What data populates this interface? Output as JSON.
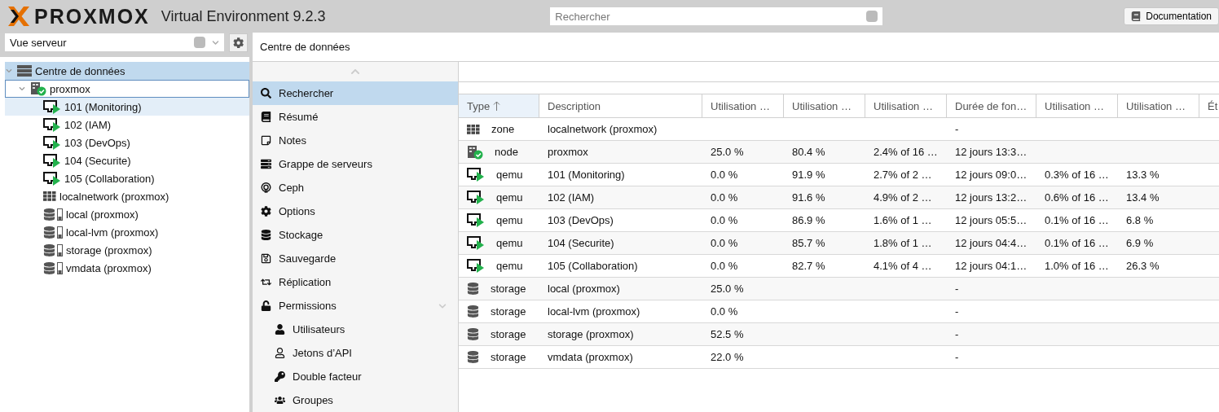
{
  "header": {
    "logo": "PROXMOX",
    "product": "Virtual Environment 9.2.3",
    "search": {
      "placeholder": "Rechercher"
    },
    "buttons": [
      {
        "label": "Documentation"
      }
    ]
  },
  "sidebar": {
    "view_select": {
      "value": "Vue serveur"
    },
    "tree": [
      {
        "label": "Centre de données",
        "kind": "datacenter",
        "selected": true,
        "focused": false,
        "hovered": false,
        "expanded": true,
        "children": [
          {
            "label": "proxmox",
            "kind": "node",
            "selected": false,
            "focused": true,
            "hovered": false,
            "expanded": true,
            "children": [
              {
                "label": "101 (Monitoring)",
                "kind": "vm",
                "selected": false,
                "focused": false,
                "hovered": true
              },
              {
                "label": "102 (IAM)",
                "kind": "vm",
                "selected": false,
                "focused": false,
                "hovered": false
              },
              {
                "label": "103 (DevOps)",
                "kind": "vm",
                "selected": false,
                "focused": false,
                "hovered": false
              },
              {
                "label": "104 (Securite)",
                "kind": "vm",
                "selected": false,
                "focused": false,
                "hovered": false
              },
              {
                "label": "105 (Collaboration)",
                "kind": "vm",
                "selected": false,
                "focused": false,
                "hovered": false
              },
              {
                "label": "localnetwork (proxmox)",
                "kind": "zone",
                "selected": false,
                "focused": false,
                "hovered": false
              },
              {
                "label": "local (proxmox)",
                "kind": "storage",
                "selected": false,
                "focused": false,
                "hovered": false
              },
              {
                "label": "local-lvm (proxmox)",
                "kind": "storage",
                "selected": false,
                "focused": false,
                "hovered": false
              },
              {
                "label": "storage (proxmox)",
                "kind": "storage",
                "selected": false,
                "focused": false,
                "hovered": false
              },
              {
                "label": "vmdata (proxmox)",
                "kind": "storage",
                "selected": false,
                "focused": false,
                "hovered": false
              }
            ]
          }
        ]
      }
    ]
  },
  "content": {
    "title": "Centre de données",
    "nav": [
      {
        "label": "Rechercher",
        "selected": true
      },
      {
        "label": "Résumé",
        "selected": false
      },
      {
        "label": "Notes",
        "selected": false
      },
      {
        "label": "Grappe de serveurs",
        "selected": false
      },
      {
        "label": "Ceph",
        "selected": false
      },
      {
        "label": "Options",
        "selected": false
      },
      {
        "label": "Stockage",
        "selected": false
      },
      {
        "label": "Sauvegarde",
        "selected": false
      },
      {
        "label": "Réplication",
        "selected": false
      },
      {
        "label": "Permissions",
        "selected": false,
        "expanded": true,
        "children": [
          {
            "label": "Utilisateurs",
            "selected": false
          },
          {
            "label": "Jetons d’API",
            "selected": false
          },
          {
            "label": "Double facteur",
            "selected": false
          },
          {
            "label": "Groupes",
            "selected": false
          }
        ]
      }
    ],
    "table": {
      "columns": [
        {
          "label": "Type",
          "sorted": true
        },
        {
          "label": "Description",
          "sorted": false
        },
        {
          "label": "Utilisation …",
          "sorted": false
        },
        {
          "label": "Utilisation …",
          "sorted": false
        },
        {
          "label": "Utilisation …",
          "sorted": false
        },
        {
          "label": "Durée de fon…",
          "sorted": false
        },
        {
          "label": "Utilisation …",
          "sorted": false
        },
        {
          "label": "Utilisation …",
          "sorted": false
        },
        {
          "label": "Ét",
          "sorted": false
        }
      ],
      "rows": [
        {
          "kind": "zone",
          "cells": [
            "zone",
            "localnetwork (proxmox)",
            "",
            "",
            "",
            "-",
            "",
            ""
          ]
        },
        {
          "kind": "node",
          "cells": [
            "node",
            "proxmox",
            "25.0 %",
            "80.4 %",
            "2.4% of 16 …",
            "12 jours 13:3…",
            "",
            ""
          ]
        },
        {
          "kind": "vm",
          "cells": [
            "qemu",
            "101 (Monitoring)",
            "0.0 %",
            "91.9 %",
            "2.7% of 2 …",
            "12 jours 09:0…",
            "0.3% of 16 …",
            "13.3 %"
          ]
        },
        {
          "kind": "vm",
          "cells": [
            "qemu",
            "102 (IAM)",
            "0.0 %",
            "91.6 %",
            "4.9% of 2 …",
            "12 jours 13:2…",
            "0.6% of 16 …",
            "13.4 %"
          ]
        },
        {
          "kind": "vm",
          "cells": [
            "qemu",
            "103 (DevOps)",
            "0.0 %",
            "86.9 %",
            "1.6% of 1 …",
            "12 jours 05:5…",
            "0.1% of 16 …",
            "6.8 %"
          ]
        },
        {
          "kind": "vm",
          "cells": [
            "qemu",
            "104 (Securite)",
            "0.0 %",
            "85.7 %",
            "1.8% of 1 …",
            "12 jours 04:4…",
            "0.1% of 16 …",
            "6.9 %"
          ]
        },
        {
          "kind": "vm",
          "cells": [
            "qemu",
            "105 (Collaboration)",
            "0.0 %",
            "82.7 %",
            "4.1% of 4 …",
            "12 jours 04:1…",
            "1.0% of 16 …",
            "26.3 %"
          ]
        },
        {
          "kind": "storage",
          "cells": [
            "storage",
            "local (proxmox)",
            "25.0 %",
            "",
            "",
            "-",
            "",
            ""
          ]
        },
        {
          "kind": "storage",
          "cells": [
            "storage",
            "local-lvm (proxmox)",
            "0.0 %",
            "",
            "",
            "-",
            "",
            ""
          ]
        },
        {
          "kind": "storage",
          "cells": [
            "storage",
            "storage (proxmox)",
            "52.5 %",
            "",
            "",
            "-",
            "",
            ""
          ]
        },
        {
          "kind": "storage",
          "cells": [
            "storage",
            "vmdata (proxmox)",
            "22.0 %",
            "",
            "",
            "-",
            "",
            ""
          ]
        }
      ]
    }
  }
}
